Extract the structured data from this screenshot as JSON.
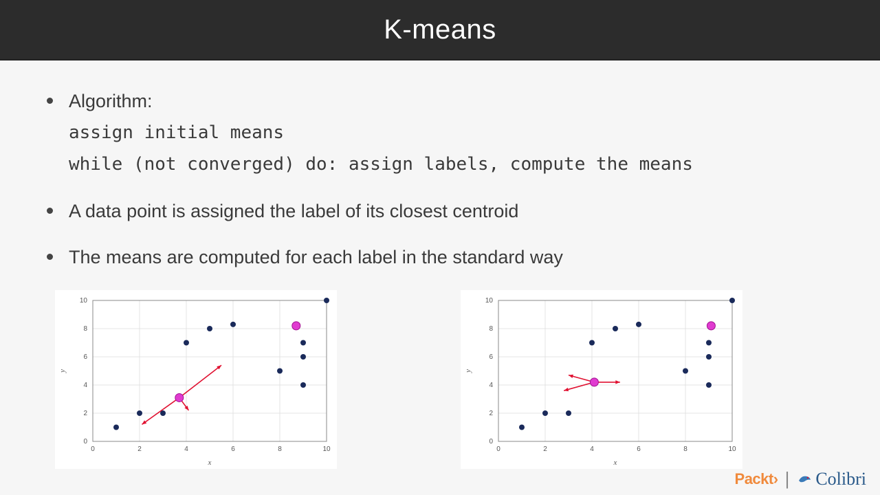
{
  "header": {
    "title": "K-means"
  },
  "bullets": [
    {
      "text": "Algorithm:",
      "code": [
        "assign initial means",
        "while (not converged) do: assign labels, compute the means"
      ]
    },
    {
      "text": "A data point is assigned the label of its closest centroid"
    },
    {
      "text": "The means are computed for each label in the standard way"
    }
  ],
  "chart_data": [
    {
      "type": "scatter",
      "xlabel": "x",
      "ylabel": "y",
      "xlim": [
        0,
        10
      ],
      "ylim": [
        0,
        10
      ],
      "xticks": [
        0,
        2,
        4,
        6,
        8,
        10
      ],
      "yticks": [
        0,
        2,
        4,
        6,
        8,
        10
      ],
      "series": [
        {
          "name": "data",
          "color": "#1a2a5a",
          "points": [
            [
              1,
              1
            ],
            [
              2,
              2
            ],
            [
              3,
              2
            ],
            [
              4,
              7
            ],
            [
              5,
              8
            ],
            [
              6,
              8.3
            ],
            [
              8,
              5
            ],
            [
              9,
              4
            ],
            [
              9,
              6
            ],
            [
              9,
              7
            ],
            [
              10,
              10
            ]
          ]
        },
        {
          "name": "centroids",
          "color": "#e03bd0",
          "points": [
            [
              3.7,
              3.1
            ],
            [
              8.7,
              8.2
            ]
          ]
        }
      ],
      "arrows": {
        "from": [
          3.7,
          3.1
        ],
        "to": [
          [
            2.1,
            1.2
          ],
          [
            4.1,
            2.2
          ],
          [
            5.5,
            5.4
          ]
        ],
        "color": "#e01030"
      }
    },
    {
      "type": "scatter",
      "xlabel": "x",
      "ylabel": "y",
      "xlim": [
        0,
        10
      ],
      "ylim": [
        0,
        10
      ],
      "xticks": [
        0,
        2,
        4,
        6,
        8,
        10
      ],
      "yticks": [
        0,
        2,
        4,
        6,
        8,
        10
      ],
      "series": [
        {
          "name": "data",
          "color": "#1a2a5a",
          "points": [
            [
              1,
              1
            ],
            [
              2,
              2
            ],
            [
              3,
              2
            ],
            [
              4,
              7
            ],
            [
              5,
              8
            ],
            [
              6,
              8.3
            ],
            [
              8,
              5
            ],
            [
              9,
              4
            ],
            [
              9,
              6
            ],
            [
              9,
              7
            ],
            [
              10,
              10
            ]
          ]
        },
        {
          "name": "centroids",
          "color": "#e03bd0",
          "points": [
            [
              4.1,
              4.2
            ],
            [
              9.1,
              8.2
            ]
          ]
        }
      ],
      "arrows": {
        "from": [
          4.1,
          4.2
        ],
        "to": [
          [
            2.8,
            3.6
          ],
          [
            5.2,
            4.2
          ],
          [
            3.0,
            4.7
          ]
        ],
        "color": "#e01030"
      }
    }
  ],
  "footer": {
    "brand1": "Packt",
    "brand1_suffix": "›",
    "separator": "|",
    "brand2": "Colibri"
  }
}
